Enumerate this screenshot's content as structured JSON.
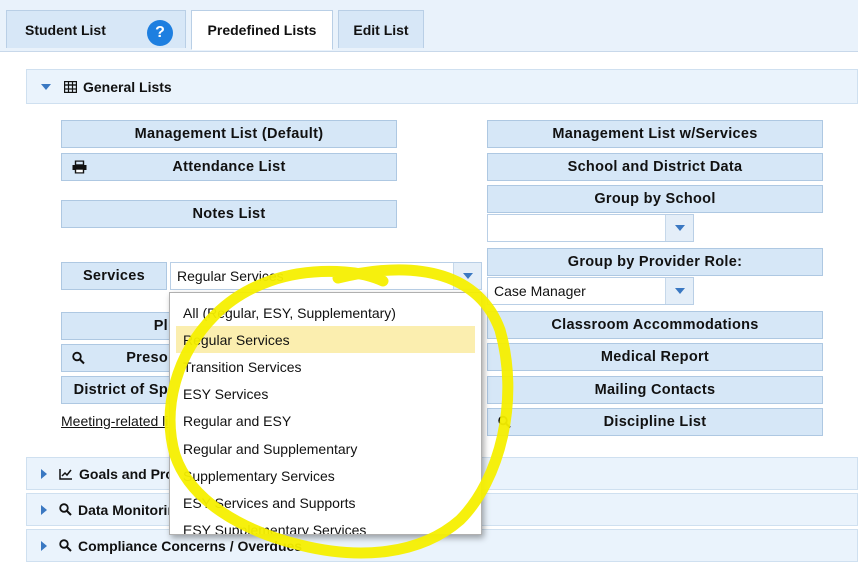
{
  "tabs": {
    "student_list": "Student List",
    "help": "?",
    "predefined_lists": "Predefined Lists",
    "edit_list": "Edit List"
  },
  "sections": {
    "general_lists": "General Lists",
    "goals": "Goals and Progress",
    "data_monitor": "Data Monitoring",
    "compliance": "Compliance Concerns / Overdues"
  },
  "left_buttons": {
    "management_list": "Management List (Default)",
    "attendance_list": "Attendance List",
    "notes_list": "Notes List",
    "plan_btn": "Pl",
    "prescribed_btn": "Preso",
    "district_btn": "District of Sp"
  },
  "services": {
    "label": "Services",
    "selected": "Regular Services"
  },
  "dropdown_options": [
    "All (Regular, ESY, Supplementary)",
    "Regular Services",
    "Transition Services",
    "ESY Services",
    "Regular and ESY",
    "Regular and Supplementary",
    "Supplementary Services",
    "ESY Services and Supports",
    "ESY Supplementary Services"
  ],
  "right_buttons": {
    "mgmt_services": "Management List w/Services",
    "school_district": "School and District Data",
    "group_school": "Group by School",
    "group_provider": "Group by Provider Role:",
    "provider_value": "Case Manager",
    "classroom": "Classroom Accommodations",
    "medical": "Medical Report",
    "mailing": "Mailing Contacts",
    "discipline": "Discipline List"
  },
  "meeting_link": "Meeting-related li",
  "colors": {
    "accent": "#1e7fe0",
    "highlight": "#f5ef00",
    "button_bg": "#d6e7f7"
  }
}
